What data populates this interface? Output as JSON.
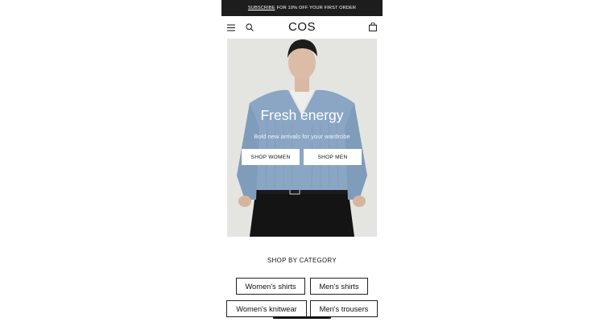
{
  "promo": {
    "link_label": "SUBSCRIBE",
    "text": "FOR 10% OFF YOUR FIRST ORDER"
  },
  "header": {
    "logo": "COS",
    "icons": [
      "menu-icon",
      "search-icon",
      "shopping-bag-icon"
    ]
  },
  "hero": {
    "title": "Fresh energy",
    "subtitle": "Bold new arrivals for your wardrobe",
    "buttons": {
      "shop_women": "SHOP WOMEN",
      "shop_men": "SHOP MEN"
    }
  },
  "categories": {
    "heading": "SHOP BY CATEGORY",
    "items": [
      "Women's shirts",
      "Men's shirts",
      "Women's knitwear",
      "Men's trousers"
    ]
  },
  "colors": {
    "promo_bg": "#1d1d1d",
    "hero_sweater": "#8aa6c4",
    "text": "#111111"
  }
}
